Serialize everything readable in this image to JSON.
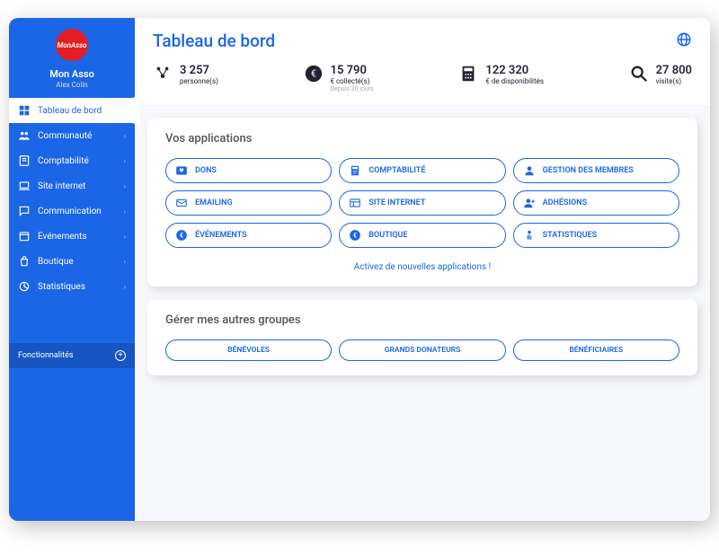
{
  "sidebar": {
    "org_name": "Mon Asso",
    "user_name": "Alex Colin",
    "logo_text": "MonAsso",
    "items": [
      {
        "label": "Tableau de bord",
        "active": true,
        "icon": "dashboard"
      },
      {
        "label": "Communauté",
        "icon": "people"
      },
      {
        "label": "Comptabilité",
        "icon": "book"
      },
      {
        "label": "Site internet",
        "icon": "laptop"
      },
      {
        "label": "Communication",
        "icon": "chat"
      },
      {
        "label": "Evénements",
        "icon": "calendar"
      },
      {
        "label": "Boutique",
        "icon": "bag"
      },
      {
        "label": "Statistiques",
        "icon": "pie"
      }
    ],
    "features_label": "Fonctionnalités"
  },
  "header": {
    "title": "Tableau de bord"
  },
  "stats": [
    {
      "value": "3 257",
      "label": "personne(s)",
      "icon": "people"
    },
    {
      "value": "15 790",
      "label": "€ collecté(s)",
      "sub": "Depuis 30 jours",
      "icon": "euro"
    },
    {
      "value": "122 320",
      "label": "€ de disponibilités",
      "icon": "calc"
    },
    {
      "value": "27 800",
      "label": "visite(s)",
      "icon": "search"
    }
  ],
  "apps": {
    "title": "Vos applications",
    "items": [
      {
        "label": "DONS",
        "icon": "heart"
      },
      {
        "label": "COMPTABILITÉ",
        "icon": "calc"
      },
      {
        "label": "GESTION DES MEMBRES",
        "icon": "person"
      },
      {
        "label": "EMAILING",
        "icon": "mail"
      },
      {
        "label": "SITE INTERNET",
        "icon": "web"
      },
      {
        "label": "ADHÉSIONS",
        "icon": "personadd"
      },
      {
        "label": "ÉVÉNEMENTS",
        "icon": "euro"
      },
      {
        "label": "BOUTIQUE",
        "icon": "euro"
      },
      {
        "label": "STATISTIQUES",
        "icon": "stats"
      }
    ],
    "activate": "Activez de nouvelles applications !"
  },
  "groups": {
    "title": "Gérer mes autres groupes",
    "items": [
      "BÉNÉVOLES",
      "GRANDS DONATEURS",
      "BÉNÉFICIAIRES"
    ]
  }
}
